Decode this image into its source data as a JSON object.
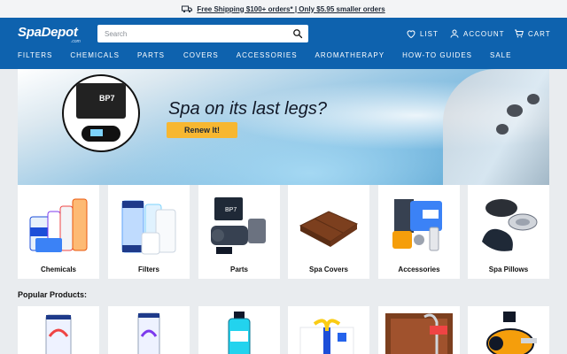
{
  "promo": {
    "text": "Free Shipping $100+ orders* | Only $5.95 smaller orders",
    "icon": "truck-icon"
  },
  "header": {
    "logo": "SpaDepot",
    "logo_sub": ".com",
    "search_placeholder": "Search",
    "list_label": "LIST",
    "account_label": "ACCOUNT",
    "cart_label": "CART"
  },
  "nav": [
    "FILTERS",
    "CHEMICALS",
    "PARTS",
    "COVERS",
    "ACCESSORIES",
    "AROMATHERAPY",
    "HOW-TO GUIDES",
    "SALE"
  ],
  "hero": {
    "headline": "Spa on its last legs?",
    "button": "Renew It!",
    "product_label": "BP7"
  },
  "categories": [
    "Chemicals",
    "Filters",
    "Parts",
    "Spa Covers",
    "Accessories",
    "Spa Pillows"
  ],
  "popular_heading": "Popular Products:",
  "colors": {
    "brand_blue": "#0e62ae",
    "cta_yellow": "#f7b731",
    "page_bg": "#e9ecef"
  }
}
